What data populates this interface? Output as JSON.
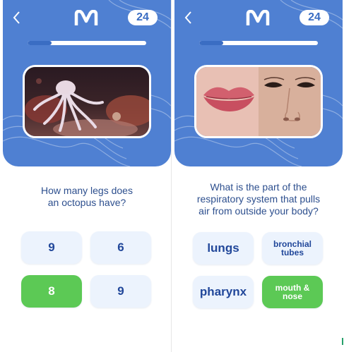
{
  "colors": {
    "header_bg": "#4f80d2",
    "progress_fill": "#3a6dc3",
    "answer_bg": "#ecf3fd",
    "answer_text": "#21479a",
    "correct_bg": "#5cc955",
    "question_text": "#2d4f8e"
  },
  "screens": [
    {
      "count": "24",
      "progress": 0.2,
      "image": "octopus-photo",
      "question_line1": "How many legs does",
      "question_line2": "an octopus have?",
      "answers": [
        "9",
        "6",
        "8",
        "9"
      ],
      "selected_correct_index": 2
    },
    {
      "count": "24",
      "progress": 0.2,
      "image": "lips-and-nose-photo",
      "question_line1": "What  is the part of the",
      "question_line2": "respiratory system that pulls",
      "question_line3": "air from outside your body?",
      "answers": [
        "lungs",
        "bronchial tubes",
        "pharynx",
        "mouth & nose"
      ],
      "selected_correct_index": 3
    }
  ],
  "icons": {
    "back": "chevron-left-icon",
    "logo": "m-logo-icon"
  }
}
